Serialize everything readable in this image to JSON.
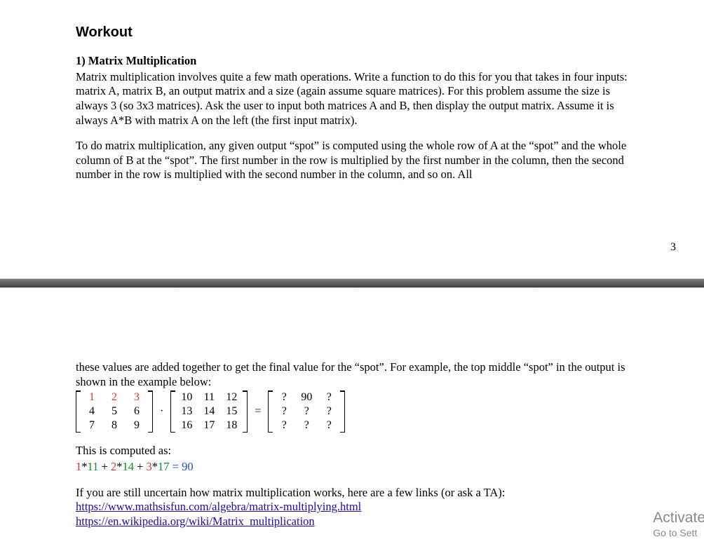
{
  "title": "Workout",
  "problem": {
    "label": "1)  Matrix Multiplication",
    "para1": "Matrix multiplication involves quite a few math operations.  Write a function to do this for you that takes in four inputs: matrix A, matrix B, an output matrix and a size (again assume square matrices). For this problem assume the size is always 3 (so 3x3 matrices). Ask the user to input both matrices A and B, then display the output matrix. Assume it is always A*B with matrix A on the left (the first input matrix).",
    "para2": "To do matrix multiplication, any given output “spot” is computed using the whole row of A at the “spot” and the whole column of B at the “spot”. The first number in the row is multiplied by the first number in the column, then the second number in the row is multiplied with the second number in the column, and so on. All"
  },
  "pageNumber": "3",
  "continuation": {
    "para3": "these values are added together to get the final value for the “spot”. For example, the top middle “spot” in the output is shown in the example below:",
    "matrixA": [
      [
        "1",
        "2",
        "3"
      ],
      [
        "4",
        "5",
        "6"
      ],
      [
        "7",
        "8",
        "9"
      ]
    ],
    "matrixB": [
      [
        "10",
        "11",
        "12"
      ],
      [
        "13",
        "14",
        "15"
      ],
      [
        "16",
        "17",
        "18"
      ]
    ],
    "matrixC": [
      [
        "?",
        "90",
        "?"
      ],
      [
        "?",
        "?",
        "?"
      ],
      [
        "?",
        "?",
        "?"
      ]
    ],
    "dot": "·",
    "equals": "=",
    "computedLabel": "This is computed as:",
    "calc": {
      "t1": "1",
      "t2": "*",
      "t3": "11",
      "t4": " + ",
      "t5": "2",
      "t6": "*",
      "t7": "14",
      "t8": " + ",
      "t9": "3",
      "t10": "*",
      "t11": "17",
      "t12": " = 90"
    },
    "para4": "If you are still uncertain how matrix multiplication works, here are a few links (or ask a TA):",
    "link1": "https://www.mathsisfun.com/algebra/matrix-multiplying.html",
    "link2": "https://en.wikipedia.org/wiki/Matrix_multiplication"
  },
  "watermark": {
    "line1": "Activate",
    "line2": "Go to Sett"
  }
}
